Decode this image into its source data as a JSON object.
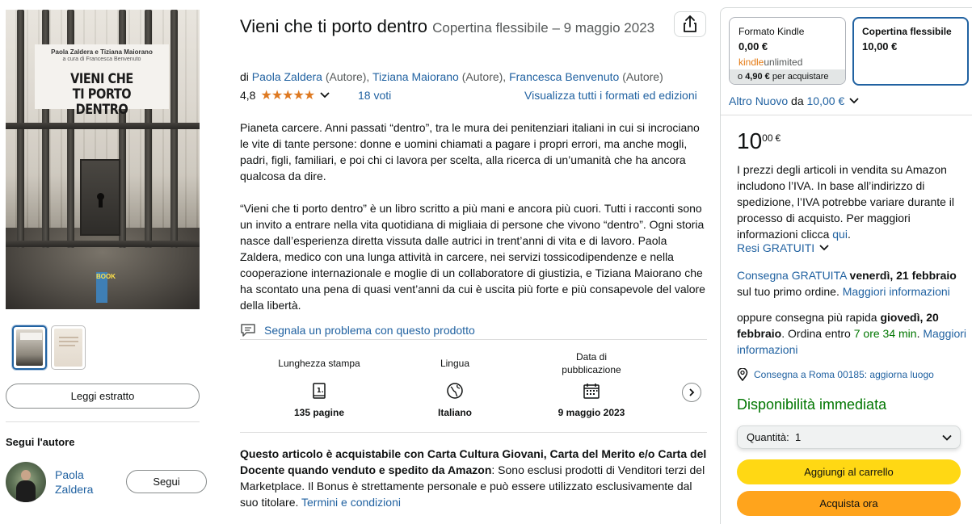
{
  "cover": {
    "authors_line": "Paola Zaldera e Tiziana Maiorano",
    "curator_line": "a cura di Francesca Benvenuto",
    "title_line1": "VIENI CHE",
    "title_line2": "TI PORTO DENTRO",
    "publisher_logo": "BOOK"
  },
  "left": {
    "read_sample": "Leggi estratto",
    "follow_heading": "Segui l'autore",
    "author_first": "Paola",
    "author_last": "Zaldera",
    "follow_button": "Segui"
  },
  "product": {
    "title": "Vieni che ti porto dentro",
    "format_date": "Copertina flessibile – 9 maggio 2023",
    "by": "di",
    "authors": [
      {
        "name": "Paola Zaldera",
        "role": "(Autore),"
      },
      {
        "name": "Tiziana Maiorano",
        "role": "(Autore),"
      },
      {
        "name": "Francesca Benvenuto",
        "role": "(Autore)"
      }
    ],
    "rating": "4,8",
    "rating_value": 4.8,
    "votes": "18 voti",
    "all_formats": "Visualizza tutti i formati ed edizioni",
    "description_p1": "Pianeta carcere. Anni passati “dentro”, tra le mura dei penitenziari italiani in cui si incrociano le vite di tante persone: donne e uomini chiamati a pagare i propri errori, ma anche mogli, padri, figli, familiari, e poi chi ci lavora per scelta, alla ricerca di un’umanità che ha ancora qualcosa da dire.",
    "description_p2": "“Vieni che ti porto dentro” è un libro scritto a più mani e ancora più cuori. Tutti i racconti sono un invito a entrare nella vita quotidiana di migliaia di persone che vivono “dentro”. Ogni storia nasce dall’esperienza diretta vissuta dalle autrici in trent’anni di vita e di lavoro. Paola Zaldera, medico con una lunga attività in carcere, nei servizi tossicodipendenze e nella cooperazione internazionale e moglie di un collaboratore di giustizia, e Tiziana Maiorano che ha scontato una pena di quasi vent’anni da cui è uscita più forte e più consapevole del valore della libertà.",
    "report_issue": "Segnala un problema con questo prodotto",
    "specs": [
      {
        "label": "Lunghezza stampa",
        "value": "135 pagine",
        "icon": "pages-icon"
      },
      {
        "label": "Lingua",
        "value": "Italiano",
        "icon": "globe-icon"
      },
      {
        "label": "Data di pubblicazione",
        "value": "9 maggio 2023",
        "icon": "calendar-icon"
      }
    ],
    "bonus_bold": "Questo articolo è acquistabile con Carta Cultura Giovani, Carta del Merito e/o Carta del Docente quando venduto e spedito da Amazon",
    "bonus_text": ": Sono esclusi prodotti di Venditori terzi del Marketplace. Il Bonus è strettamente personale e può essere utilizzato esclusivamente dal suo titolare.",
    "terms_link": "Termini e condizioni"
  },
  "buybox": {
    "kindle": {
      "label": "Formato Kindle",
      "price": "0,00 €",
      "ku_kindle": "kindle",
      "ku_unlimited": "unlimited",
      "buy_price": "4,90 €",
      "buy_prefix": "o",
      "buy_suffix": "per acquistare"
    },
    "paperback": {
      "label": "Copertina flessibile",
      "price": "10,00 €"
    },
    "other_new_prefix": "Altro",
    "other_new_link": "Nuovo",
    "other_new_from": "da",
    "other_new_price": "10,00 €",
    "price_whole": "10",
    "price_fraction": "00",
    "price_currency": "€",
    "vat_text": "I prezzi degli articoli in vendita su Amazon includono l’IVA. In base all’indirizzo di spedizione, l’IVA potrebbe variare durante il processo di acquisto. Per maggiori informazioni clicca",
    "vat_link": "qui",
    "returns": "Resi GRATUITI",
    "delivery_free": "Consegna GRATUITA",
    "delivery_date": "venerdì, 21 febbraio",
    "delivery_tail": "sul tuo primo ordine.",
    "more_info": "Maggiori informazioni",
    "fast_prefix": "oppure consegna più rapida",
    "fast_date": "giovedì, 20 febbraio",
    "order_within": ". Ordina entro",
    "countdown": "7 ore 34 min",
    "more_info2": "Maggiori informazioni",
    "location": "Consegna a Roma 00185: aggiorna luogo",
    "availability": "Disponibilità immediata",
    "quantity_label": "Quantità:",
    "quantity_value": "1",
    "add_to_cart": "Aggiungi al carrello",
    "buy_now": "Acquista ora"
  },
  "colors": {
    "link": "#2162a1",
    "star": "#de7921",
    "green": "#007600",
    "yellow": "#ffd814",
    "orange": "#ffa41c"
  }
}
